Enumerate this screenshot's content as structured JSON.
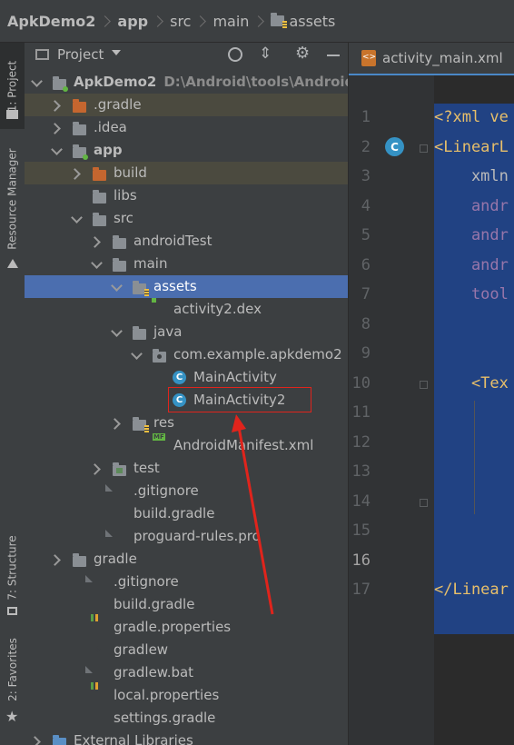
{
  "breadcrumb": {
    "project": "ApkDemo2",
    "module": "app",
    "dir1": "src",
    "dir2": "main",
    "dir3": "assets"
  },
  "side_tabs": {
    "project": "1: Project",
    "resource_manager": "Resource Manager",
    "structure": "7: Structure",
    "favorites": "2: Favorites"
  },
  "project_panel": {
    "title": "Project",
    "tree": [
      {
        "label": "ApkDemo2",
        "sublabel": "D:\\Android\\tools\\AndroidKil",
        "depth": 0,
        "arrow": "open",
        "icon": "folder-module",
        "bold": true
      },
      {
        "label": ".gradle",
        "depth": 1,
        "arrow": "closed",
        "icon": "folder-orange",
        "state": "ignored"
      },
      {
        "label": ".idea",
        "depth": 1,
        "arrow": "closed",
        "icon": "folder"
      },
      {
        "label": "app",
        "depth": 1,
        "arrow": "open",
        "icon": "folder-module",
        "bold": true
      },
      {
        "label": "build",
        "depth": 2,
        "arrow": "closed",
        "icon": "folder-orange",
        "state": "ignored"
      },
      {
        "label": "libs",
        "depth": 2,
        "arrow": "none",
        "icon": "folder"
      },
      {
        "label": "src",
        "depth": 2,
        "arrow": "open",
        "icon": "folder"
      },
      {
        "label": "androidTest",
        "depth": 3,
        "arrow": "closed",
        "icon": "folder"
      },
      {
        "label": "main",
        "depth": 3,
        "arrow": "open",
        "icon": "folder"
      },
      {
        "label": "assets",
        "depth": 4,
        "arrow": "open",
        "icon": "folder-assets",
        "state": "selected"
      },
      {
        "label": "activity2.dex",
        "depth": 5,
        "arrow": "none",
        "icon": "dex-file"
      },
      {
        "label": "java",
        "depth": 4,
        "arrow": "open",
        "icon": "folder"
      },
      {
        "label": "com.example.apkdemo2",
        "depth": 5,
        "arrow": "open",
        "icon": "folder-package"
      },
      {
        "label": "MainActivity",
        "depth": 6,
        "arrow": "none",
        "icon": "class"
      },
      {
        "label": "MainActivity2",
        "depth": 6,
        "arrow": "none",
        "icon": "class"
      },
      {
        "label": "res",
        "depth": 4,
        "arrow": "closed",
        "icon": "folder-res"
      },
      {
        "label": "AndroidManifest.xml",
        "depth": 5,
        "arrow": "none",
        "icon": "manifest-file"
      },
      {
        "label": "test",
        "depth": 3,
        "arrow": "closed",
        "icon": "folder-test"
      },
      {
        "label": ".gitignore",
        "depth": 3,
        "arrow": "none",
        "icon": "file"
      },
      {
        "label": "build.gradle",
        "depth": 3,
        "arrow": "none",
        "icon": "gradle"
      },
      {
        "label": "proguard-rules.pro",
        "depth": 3,
        "arrow": "none",
        "icon": "file"
      },
      {
        "label": "gradle",
        "depth": 1,
        "arrow": "closed",
        "icon": "folder"
      },
      {
        "label": ".gitignore",
        "depth": 2,
        "arrow": "none",
        "icon": "file"
      },
      {
        "label": "build.gradle",
        "depth": 2,
        "arrow": "none",
        "icon": "gradle"
      },
      {
        "label": "gradle.properties",
        "depth": 2,
        "arrow": "none",
        "icon": "properties"
      },
      {
        "label": "gradlew",
        "depth": 2,
        "arrow": "none",
        "icon": "terminal"
      },
      {
        "label": "gradlew.bat",
        "depth": 2,
        "arrow": "none",
        "icon": "file"
      },
      {
        "label": "local.properties",
        "depth": 2,
        "arrow": "none",
        "icon": "properties"
      },
      {
        "label": "settings.gradle",
        "depth": 2,
        "arrow": "none",
        "icon": "gradle"
      },
      {
        "label": "External Libraries",
        "depth": 0,
        "arrow": "closed",
        "icon": "libraries"
      }
    ]
  },
  "editor": {
    "tab_label": "activity_main.xml",
    "current_line": 16,
    "line_numbers": [
      "1",
      "2",
      "3",
      "4",
      "5",
      "6",
      "7",
      "8",
      "9",
      "10",
      "11",
      "12",
      "13",
      "14",
      "15",
      "16",
      "17"
    ],
    "code_lines": [
      {
        "text": "<?xml ve",
        "color": "#e8bf6a"
      },
      {
        "text": "<LinearL",
        "color": "#e8bf6a"
      },
      {
        "text": "    xmln",
        "color": "#bababa"
      },
      {
        "text": "    andr",
        "color": "#9876aa"
      },
      {
        "text": "    andr",
        "color": "#9876aa"
      },
      {
        "text": "    andr",
        "color": "#9876aa"
      },
      {
        "text": "    tool",
        "color": "#9876aa"
      },
      {
        "text": "",
        "color": "#a9b7c6"
      },
      {
        "text": "",
        "color": "#a9b7c6"
      },
      {
        "text": "    <Tex",
        "color": "#e8bf6a"
      },
      {
        "text": "",
        "color": "#a9b7c6"
      },
      {
        "text": "",
        "color": "#a9b7c6"
      },
      {
        "text": "",
        "color": "#a9b7c6"
      },
      {
        "text": "",
        "color": "#a9b7c6"
      },
      {
        "text": "",
        "color": "#a9b7c6"
      },
      {
        "text": "",
        "color": "#a9b7c6"
      },
      {
        "text": "</Linear",
        "color": "#e8bf6a"
      }
    ],
    "gutter_marker": "C"
  },
  "colors": {
    "annotation": "#e0241c",
    "selection": "#4b6eaf",
    "accent": "#4a88c7"
  }
}
